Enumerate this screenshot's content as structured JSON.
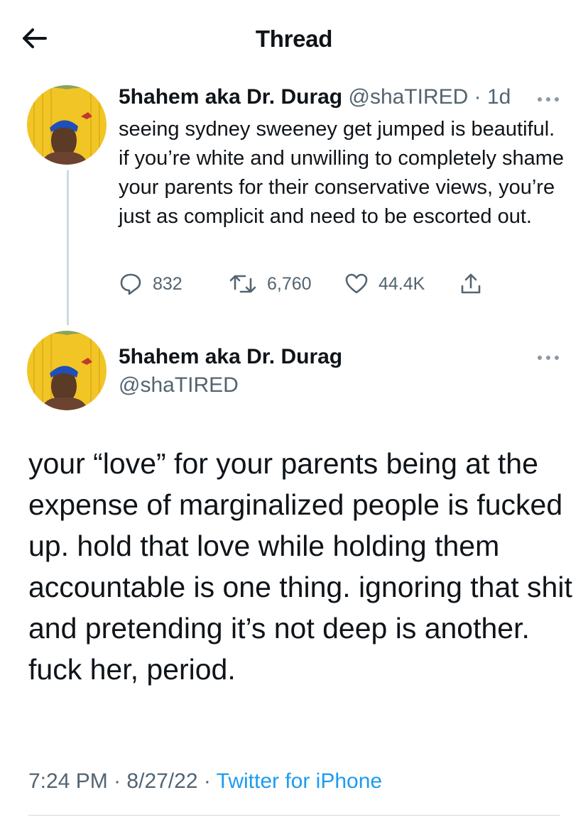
{
  "header": {
    "title": "Thread",
    "back_icon": "arrow-left-icon"
  },
  "tweet1": {
    "name": "5hahem aka Dr. Durag",
    "handle": "@shaTIRED",
    "separator": "·",
    "age": "1d",
    "text": "seeing sydney sweeney get jumped is beautiful. if you’re white and unwilling to completely shame your parents for their conservative views, you’re just as complicit and need to be escorted out.",
    "replies": "832",
    "retweets": "6,760",
    "likes": "44.4K",
    "avatar_icon": "profile-photo-icon"
  },
  "tweet2": {
    "name": "5hahem aka Dr. Durag",
    "handle": "@shaTIRED",
    "text": "your “love” for your parents being at the expense of marginalized people is fucked up. hold that love while holding them accountable is one thing. ignoring that shit and pretending it’s not deep is another. fuck her, period.",
    "time": "7:24 PM",
    "sep1": "·",
    "date": "8/27/22",
    "sep2": "·",
    "source": "Twitter for iPhone",
    "avatar_icon": "profile-photo-icon"
  },
  "colors": {
    "text": "#0f1419",
    "muted": "#536471",
    "accent": "#1d9bf0",
    "line": "#cfd9de",
    "avatar_bg": "#f2c526"
  }
}
